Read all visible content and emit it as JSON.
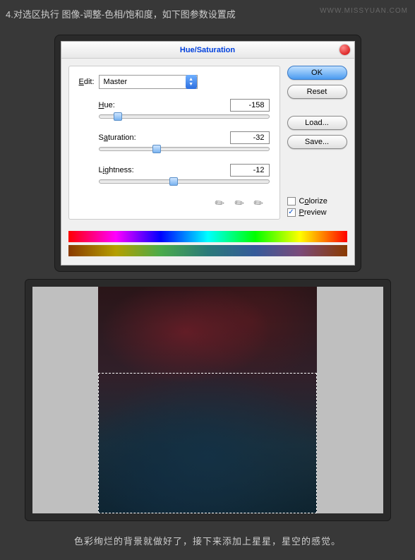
{
  "watermark": "WWW.MISSYUAN.COM",
  "instruction_top": "4.对选区执行 图像-调整-色相/饱和度，如下图参数设置成",
  "dialog": {
    "title": "Hue/Saturation",
    "edit_label": "Edit:",
    "edit_value": "Master",
    "hue": {
      "label": "Hue:",
      "value": "-158",
      "position": 11
    },
    "saturation": {
      "label": "Saturation:",
      "value": "-32",
      "position": 34
    },
    "lightness": {
      "label": "Lightness:",
      "value": "-12",
      "position": 44
    },
    "buttons": {
      "ok": "OK",
      "reset": "Reset",
      "load": "Load...",
      "save": "Save..."
    },
    "colorize": {
      "label": "Colorize",
      "checked": false
    },
    "preview": {
      "label": "Preview",
      "checked": true
    }
  },
  "instruction_bottom": "色彩绚烂的背景就做好了，接下来添加上星星，星空的感觉。"
}
